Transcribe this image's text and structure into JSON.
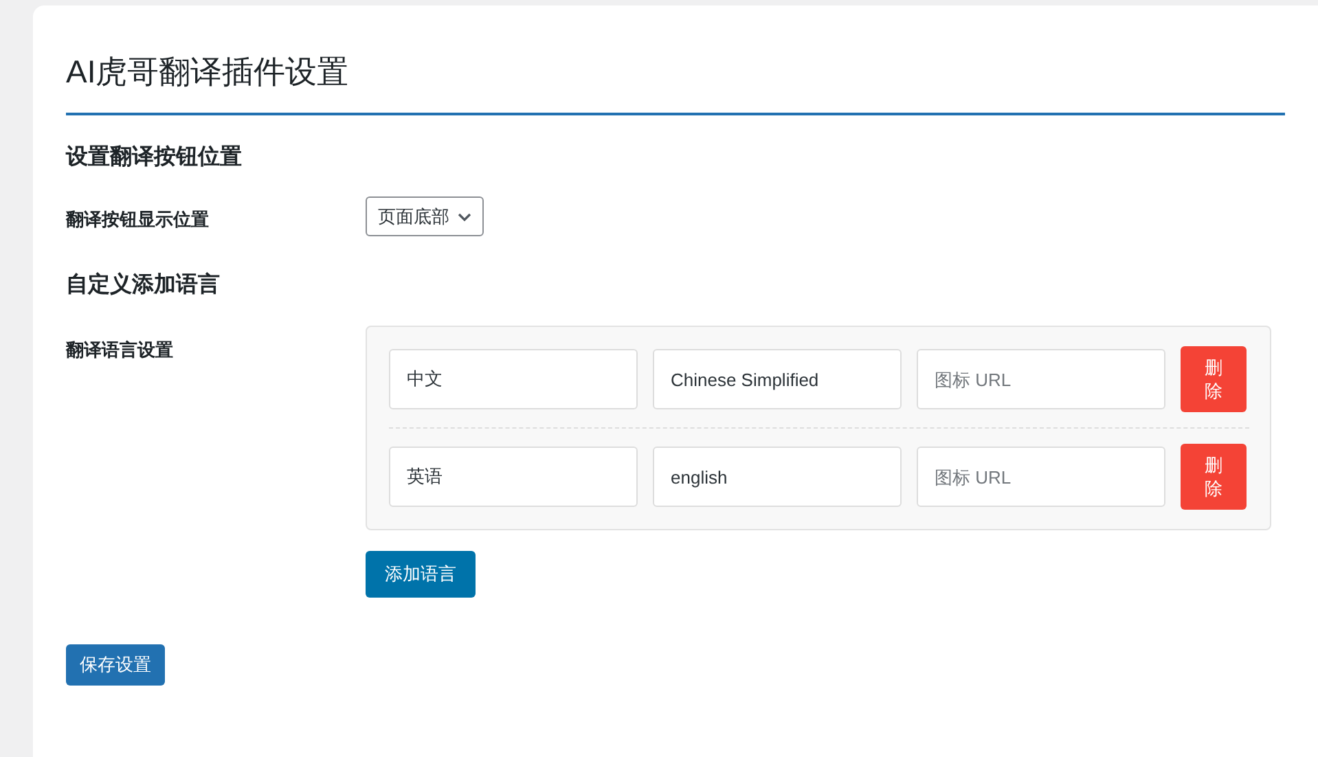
{
  "page": {
    "title": "AI虎哥翻译插件设置"
  },
  "position_section": {
    "heading": "设置翻译按钮位置",
    "label": "翻译按钮显示位置",
    "select": {
      "value": "页面底部"
    }
  },
  "language_section": {
    "heading": "自定义添加语言",
    "label": "翻译语言设置",
    "rows": [
      {
        "name": {
          "value": "中文"
        },
        "code": {
          "value": "Chinese Simplified"
        },
        "icon_url": {
          "placeholder": "图标 URL"
        },
        "delete_button": "删除"
      },
      {
        "name": {
          "value": "英语"
        },
        "code": {
          "value": "english"
        },
        "icon_url": {
          "placeholder": "图标 URL"
        },
        "delete_button": "删除"
      }
    ],
    "add_button": "添加语言"
  },
  "save_button": "保存设置"
}
